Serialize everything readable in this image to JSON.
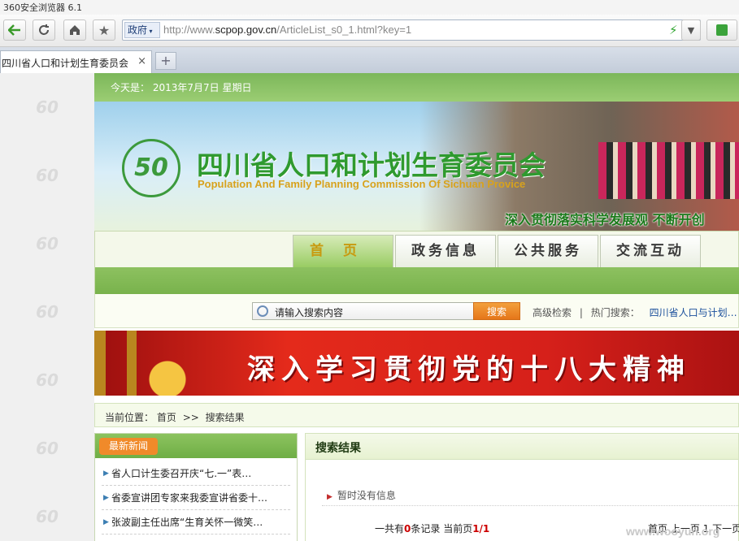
{
  "browser": {
    "title": "360安全浏览器 6.1",
    "scope_label": "政府",
    "url_prefix": "http://www.",
    "url_domain": "scpop.gov.cn",
    "url_path": "/ArticleList_s0_1.html?key=1",
    "tab_label": "四川省人口和计划生育委员会",
    "tab_close": "×",
    "new_tab": "+"
  },
  "page": {
    "date_label": "今天是：",
    "date_value": "2013年7月7日",
    "weekday": "星期日",
    "logo_glyph": "50",
    "org_cn": "四川省人口和计划生育委员会",
    "org_en": "Population And Family Planning Commission Of Sichuan Provice",
    "slogan": "深入贯彻落实科学发展观 不断开创",
    "nav": [
      "首页",
      "政务信息",
      "公共服务",
      "交流互动"
    ],
    "search_placeholder": "请输入搜索内容",
    "search_button": "搜索",
    "advanced_search": "高级检索",
    "separator": "|",
    "hot_label": "热门搜索：",
    "hot_link": "四川省人口与计划…",
    "red_banner": "深入学习贯彻党的十八大精神",
    "breadcrumb_label": "当前位置：",
    "breadcrumb_home": "首页",
    "breadcrumb_sep": ">>",
    "breadcrumb_current": "搜索结果",
    "news_title": "最新新闻",
    "news_items": [
      "省人口计生委召开庆“七.一”表…",
      "省委宣讲团专家来我委宣讲省委十…",
      "张波副主任出席“生育关怀一微笑…"
    ],
    "results_title": "搜索结果",
    "empty_text": "暂时没有信息",
    "pager_prefix": "一共有",
    "pager_count": "0",
    "pager_mid": "条记录 当前页",
    "pager_page": "1/1",
    "pager_nav": "首页 上一页 1 下一页",
    "watermark": "www.wooyun.org"
  },
  "colors": {
    "header_green": "#7cb75a",
    "nav_green": "#78b24b",
    "accent_orange": "#e5761a",
    "banner_red": "#d6201a"
  }
}
